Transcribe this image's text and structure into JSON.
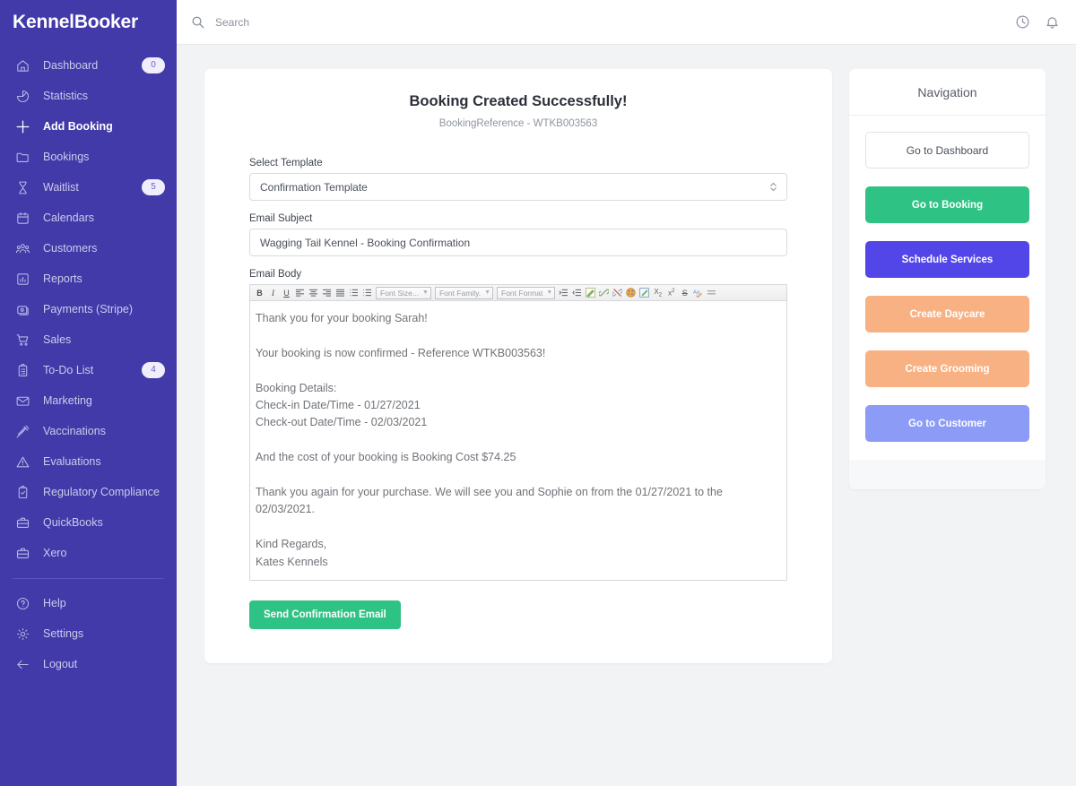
{
  "brand": {
    "name": "KennelBooker"
  },
  "sidebar": {
    "items": [
      {
        "label": "Dashboard",
        "icon": "home-icon",
        "badge": "0",
        "active": false
      },
      {
        "label": "Statistics",
        "icon": "pie-chart-icon",
        "badge": "",
        "active": false
      },
      {
        "label": "Add Booking",
        "icon": "plus-icon",
        "badge": "",
        "active": true
      },
      {
        "label": "Bookings",
        "icon": "folder-icon",
        "badge": "",
        "active": false
      },
      {
        "label": "Waitlist",
        "icon": "hourglass-icon",
        "badge": "5",
        "active": false
      },
      {
        "label": "Calendars",
        "icon": "calendar-icon",
        "badge": "",
        "active": false
      },
      {
        "label": "Customers",
        "icon": "users-icon",
        "badge": "",
        "active": false
      },
      {
        "label": "Reports",
        "icon": "bar-chart-icon",
        "badge": "",
        "active": false
      },
      {
        "label": "Payments (Stripe)",
        "icon": "card-payment-icon",
        "badge": "",
        "active": false
      },
      {
        "label": "Sales",
        "icon": "shopping-cart-icon",
        "badge": "",
        "active": false
      },
      {
        "label": "To-Do List",
        "icon": "clipboard-list-icon",
        "badge": "4",
        "active": false
      },
      {
        "label": "Marketing",
        "icon": "envelope-icon",
        "badge": "",
        "active": false
      },
      {
        "label": "Vaccinations",
        "icon": "syringe-icon",
        "badge": "",
        "active": false
      },
      {
        "label": "Evaluations",
        "icon": "warning-triangle-icon",
        "badge": "",
        "active": false
      },
      {
        "label": "Regulatory Compliance",
        "icon": "clipboard-check-icon",
        "badge": "",
        "active": false
      },
      {
        "label": "QuickBooks",
        "icon": "briefcase-icon",
        "badge": "",
        "active": false
      },
      {
        "label": "Xero",
        "icon": "briefcase-icon",
        "badge": "",
        "active": false
      }
    ],
    "footer_items": [
      {
        "label": "Help",
        "icon": "question-circle-icon"
      },
      {
        "label": "Settings",
        "icon": "gear-icon"
      },
      {
        "label": "Logout",
        "icon": "arrow-left-icon"
      }
    ]
  },
  "topbar": {
    "search_placeholder": "Search",
    "search_value": "",
    "icons": [
      {
        "name": "clock-icon"
      },
      {
        "name": "bell-icon"
      }
    ]
  },
  "form": {
    "title": "Booking Created Successfully!",
    "subtitle": "BookingReference - WTKB003563",
    "select_template_label": "Select Template",
    "select_template_value": "Confirmation Template",
    "email_subject_label": "Email Subject",
    "email_subject_value": "Wagging Tail Kennel - Booking Confirmation",
    "email_body_label": "Email Body",
    "email_body_value": "Thank you for your booking Sarah!\n\nYour booking is now confirmed - Reference WTKB003563!\n\nBooking Details:\nCheck-in Date/Time - 01/27/2021\nCheck-out Date/Time - 02/03/2021\n\nAnd the cost of your booking is Booking Cost $74.25\n\nThank you again for your purchase. We will see you and Sophie on from the 01/27/2021 to the 02/03/2021.\n\nKind Regards,\nKates Kennels",
    "send_button": "Send Confirmation Email"
  },
  "editor_toolbar": {
    "buttons_left": [
      {
        "name": "bold-icon",
        "glyph": "B"
      },
      {
        "name": "italic-icon",
        "glyph": "I"
      },
      {
        "name": "underline-icon",
        "glyph": "U"
      },
      {
        "name": "align-left-icon",
        "glyph": ""
      },
      {
        "name": "align-center-icon",
        "glyph": ""
      },
      {
        "name": "align-right-icon",
        "glyph": ""
      },
      {
        "name": "align-justify-icon",
        "glyph": ""
      },
      {
        "name": "numbered-list-icon",
        "glyph": ""
      },
      {
        "name": "bulleted-list-icon",
        "glyph": ""
      }
    ],
    "selects": [
      {
        "name": "font-size-select",
        "label": "Font Size..."
      },
      {
        "name": "font-family-select",
        "label": "Font Family."
      },
      {
        "name": "font-format-select",
        "label": "Font Format"
      }
    ],
    "buttons_right": [
      {
        "name": "indent-icon"
      },
      {
        "name": "outdent-icon"
      },
      {
        "name": "edit-pencil-icon"
      },
      {
        "name": "insert-link-icon"
      },
      {
        "name": "remove-link-icon"
      },
      {
        "name": "text-color-icon"
      },
      {
        "name": "insert-note-icon"
      },
      {
        "name": "subscript-icon"
      },
      {
        "name": "superscript-icon"
      },
      {
        "name": "strikethrough-icon"
      },
      {
        "name": "spellcheck-icon"
      },
      {
        "name": "horizontal-rule-icon"
      }
    ]
  },
  "navigation_panel": {
    "title": "Navigation",
    "buttons": [
      {
        "label": "Go to Dashboard",
        "style": "outline",
        "color": "#ffffff"
      },
      {
        "label": "Go to Booking",
        "style": "filled",
        "color": "#2fc285"
      },
      {
        "label": "Schedule Services",
        "style": "filled",
        "color": "#5346e8"
      },
      {
        "label": "Create Daycare",
        "style": "filled",
        "color": "#f8b183"
      },
      {
        "label": "Create Grooming",
        "style": "filled",
        "color": "#f8b183"
      },
      {
        "label": "Go to Customer",
        "style": "filled",
        "color": "#8c9bf5"
      }
    ]
  },
  "colors": {
    "sidebar_bg": "#413aa8",
    "page_bg": "#f2f3f5",
    "accent_green": "#2fc285",
    "accent_purple": "#5346e8",
    "accent_orange": "#f8b183",
    "accent_blue": "#8c9bf5"
  }
}
